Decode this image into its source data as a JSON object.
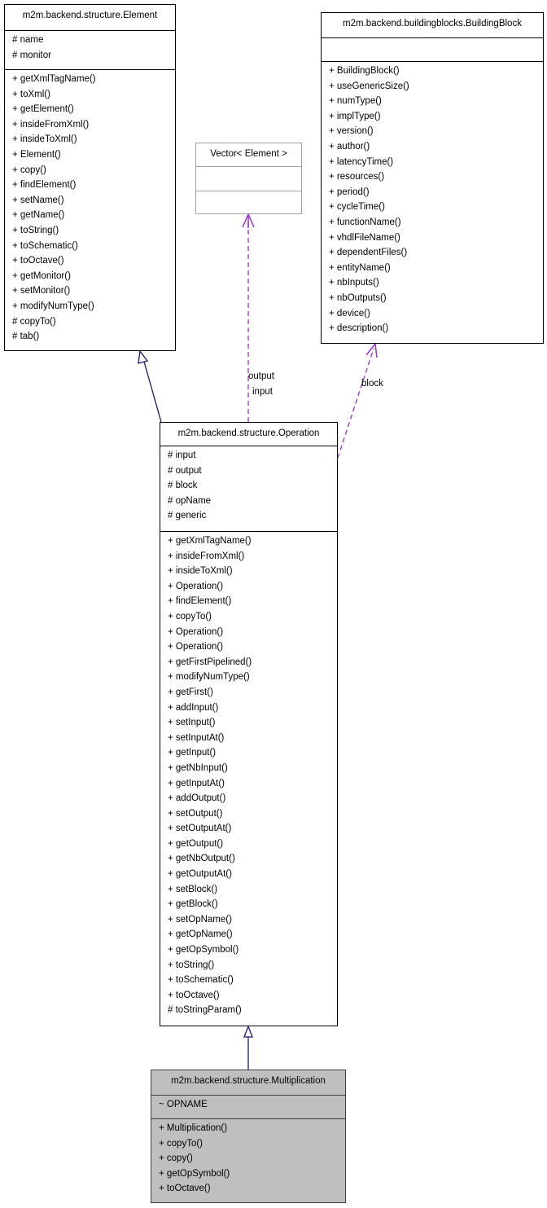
{
  "colors": {
    "inheritance_edge": "#191970",
    "usage_edge": "#9a32cd",
    "focus_fill": "#bfbfbf",
    "template_border": "#a0a0a0"
  },
  "classes": {
    "element": {
      "name": "m2m.backend.structure.Element",
      "attributes": [
        "# name",
        "# monitor"
      ],
      "methods": [
        "+ getXmlTagName()",
        "+ toXml()",
        "+ getElement()",
        "+ insideFromXml()",
        "+ insideToXml()",
        "+ Element()",
        "+ copy()",
        "+ findElement()",
        "+ setName()",
        "+ getName()",
        "+ toString()",
        "+ toSchematic()",
        "+ toOctave()",
        "+ getMonitor()",
        "+ setMonitor()",
        "+ modifyNumType()",
        "# copyTo()",
        "# tab()"
      ]
    },
    "vector": {
      "name": "Vector< Element >",
      "attributes": [],
      "methods": []
    },
    "building_block": {
      "name": "m2m.backend.buildingblocks.BuildingBlock",
      "attributes": [],
      "methods": [
        "+ BuildingBlock()",
        "+ useGenericSize()",
        "+ numType()",
        "+ implType()",
        "+ version()",
        "+ author()",
        "+ latencyTime()",
        "+ resources()",
        "+ period()",
        "+ cycleTime()",
        "+ functionName()",
        "+ vhdlFileName()",
        "+ dependentFiles()",
        "+ entityName()",
        "+ nbInputs()",
        "+ nbOutputs()",
        "+ device()",
        "+ description()"
      ]
    },
    "operation": {
      "name": "m2m.backend.structure.Operation",
      "attributes": [
        "# input",
        "# output",
        "# block",
        "# opName",
        "# generic"
      ],
      "methods": [
        "+ getXmlTagName()",
        "+ insideFromXml()",
        "+ insideToXml()",
        "+ Operation()",
        "+ findElement()",
        "+ copyTo()",
        "+ Operation()",
        "+ Operation()",
        "+ getFirstPipelined()",
        "+ modifyNumType()",
        "+ getFirst()",
        "+ addInput()",
        "+ setInput()",
        "+ setInputAt()",
        "+ getInput()",
        "+ getNbInput()",
        "+ getInputAt()",
        "+ addOutput()",
        "+ setOutput()",
        "+ setOutputAt()",
        "+ getOutput()",
        "+ getNbOutput()",
        "+ getOutputAt()",
        "+ setBlock()",
        "+ getBlock()",
        "+ setOpName()",
        "+ getOpName()",
        "+ getOpSymbol()",
        "+ toString()",
        "+ toSchematic()",
        "+ toOctave()",
        "# toStringParam()"
      ]
    },
    "multiplication": {
      "name": "m2m.backend.structure.Multiplication",
      "attributes": [
        "~ OPNAME"
      ],
      "methods": [
        "+ Multiplication()",
        "+ copyTo()",
        "+ copy()",
        "+ getOpSymbol()",
        "+ toOctave()"
      ]
    }
  },
  "edges": [
    {
      "from": "operation",
      "to": "element",
      "kind": "inheritance",
      "labels": []
    },
    {
      "from": "operation",
      "to": "vector",
      "kind": "usage",
      "labels": [
        "output",
        "input"
      ]
    },
    {
      "from": "operation",
      "to": "building_block",
      "kind": "usage",
      "labels": [
        "block"
      ]
    },
    {
      "from": "multiplication",
      "to": "operation",
      "kind": "inheritance",
      "labels": []
    }
  ]
}
